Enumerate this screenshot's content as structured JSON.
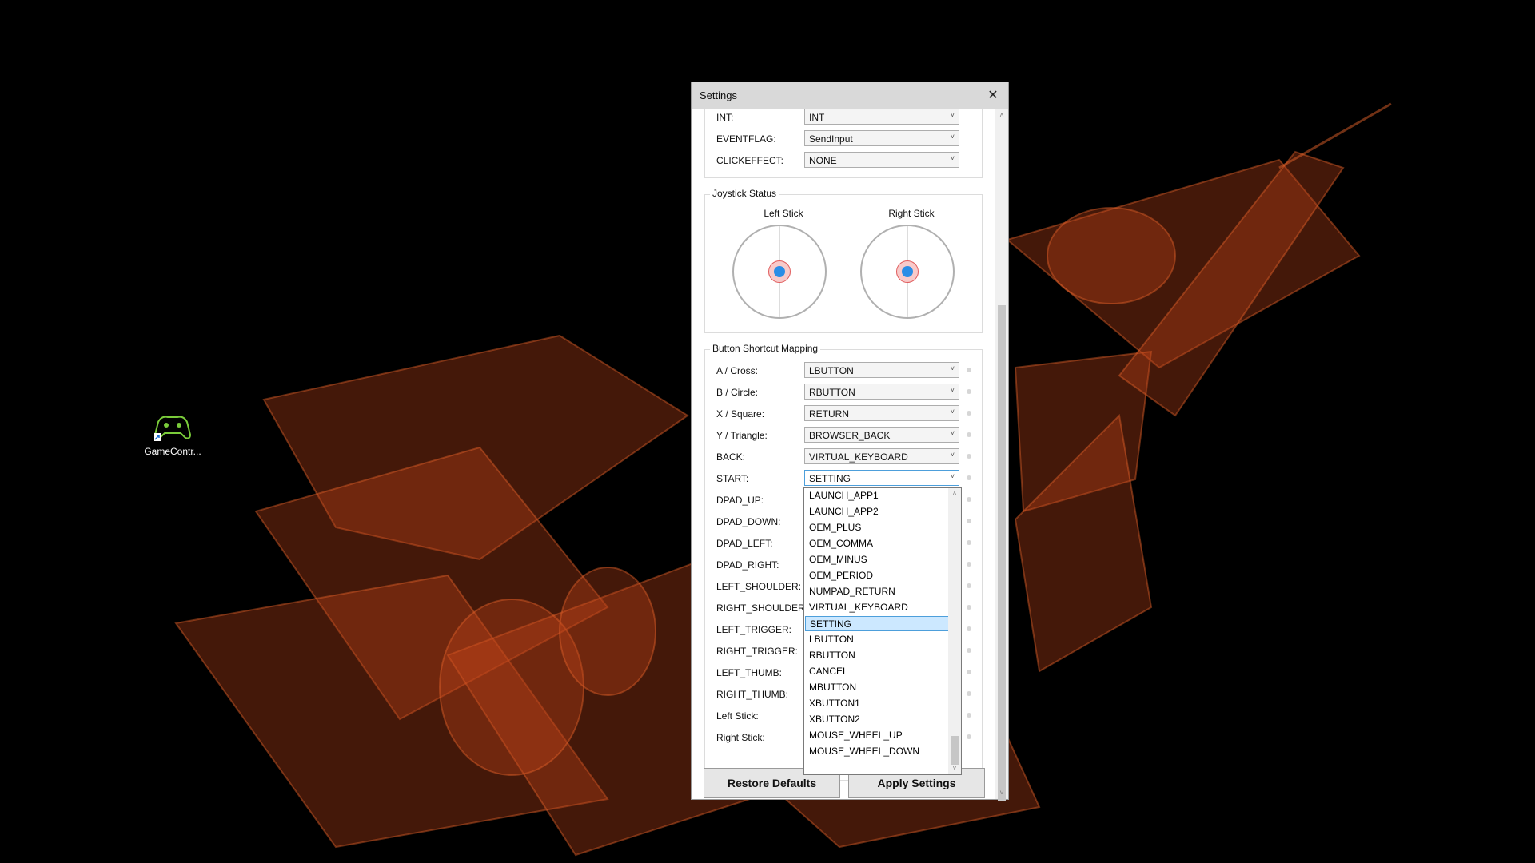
{
  "desktop": {
    "icon_label": "GameContr..."
  },
  "window": {
    "title": "Settings",
    "close_glyph": "✕"
  },
  "top_rows": [
    {
      "label": "INT:",
      "value": "INT"
    },
    {
      "label": "EVENTFLAG:",
      "value": "SendInput"
    },
    {
      "label": "CLICKEFFECT:",
      "value": "NONE"
    }
  ],
  "joystick": {
    "title": "Joystick Status",
    "left_label": "Left Stick",
    "right_label": "Right Stick"
  },
  "mapping": {
    "title": "Button Shortcut Mapping",
    "rows": [
      {
        "label": "A / Cross:",
        "value": "LBUTTON"
      },
      {
        "label": "B / Circle:",
        "value": "RBUTTON"
      },
      {
        "label": "X / Square:",
        "value": "RETURN"
      },
      {
        "label": "Y / Triangle:",
        "value": "BROWSER_BACK"
      },
      {
        "label": "BACK:",
        "value": "VIRTUAL_KEYBOARD"
      },
      {
        "label": "START:",
        "value": "SETTING"
      },
      {
        "label": "DPAD_UP:",
        "value": ""
      },
      {
        "label": "DPAD_DOWN:",
        "value": ""
      },
      {
        "label": "DPAD_LEFT:",
        "value": ""
      },
      {
        "label": "DPAD_RIGHT:",
        "value": ""
      },
      {
        "label": "LEFT_SHOULDER:",
        "value": ""
      },
      {
        "label": "RIGHT_SHOULDER:",
        "value": ""
      },
      {
        "label": "LEFT_TRIGGER:",
        "value": ""
      },
      {
        "label": "RIGHT_TRIGGER:",
        "value": ""
      },
      {
        "label": "LEFT_THUMB:",
        "value": ""
      },
      {
        "label": "RIGHT_THUMB:",
        "value": ""
      },
      {
        "label": "Left Stick:",
        "value": ""
      },
      {
        "label": "Right Stick:",
        "value": ""
      }
    ]
  },
  "dropdown": {
    "items": [
      "LAUNCH_APP1",
      "LAUNCH_APP2",
      "OEM_PLUS",
      "OEM_COMMA",
      "OEM_MINUS",
      "OEM_PERIOD",
      "NUMPAD_RETURN",
      "VIRTUAL_KEYBOARD",
      "SETTING",
      "LBUTTON",
      "RBUTTON",
      "CANCEL",
      "MBUTTON",
      "XBUTTON1",
      "XBUTTON2",
      "MOUSE_WHEEL_UP",
      "MOUSE_WHEEL_DOWN"
    ],
    "selected": "SETTING"
  },
  "buttons": {
    "restore": "Restore Defaults",
    "apply": "Apply Settings"
  },
  "icons": {
    "chevron": "˅",
    "scroll_up": "˄",
    "scroll_down": "˅"
  },
  "colors": {
    "wallpaper_accent": "#c2461b",
    "selection": "#cce8ff",
    "knob": "#2a8de6"
  }
}
